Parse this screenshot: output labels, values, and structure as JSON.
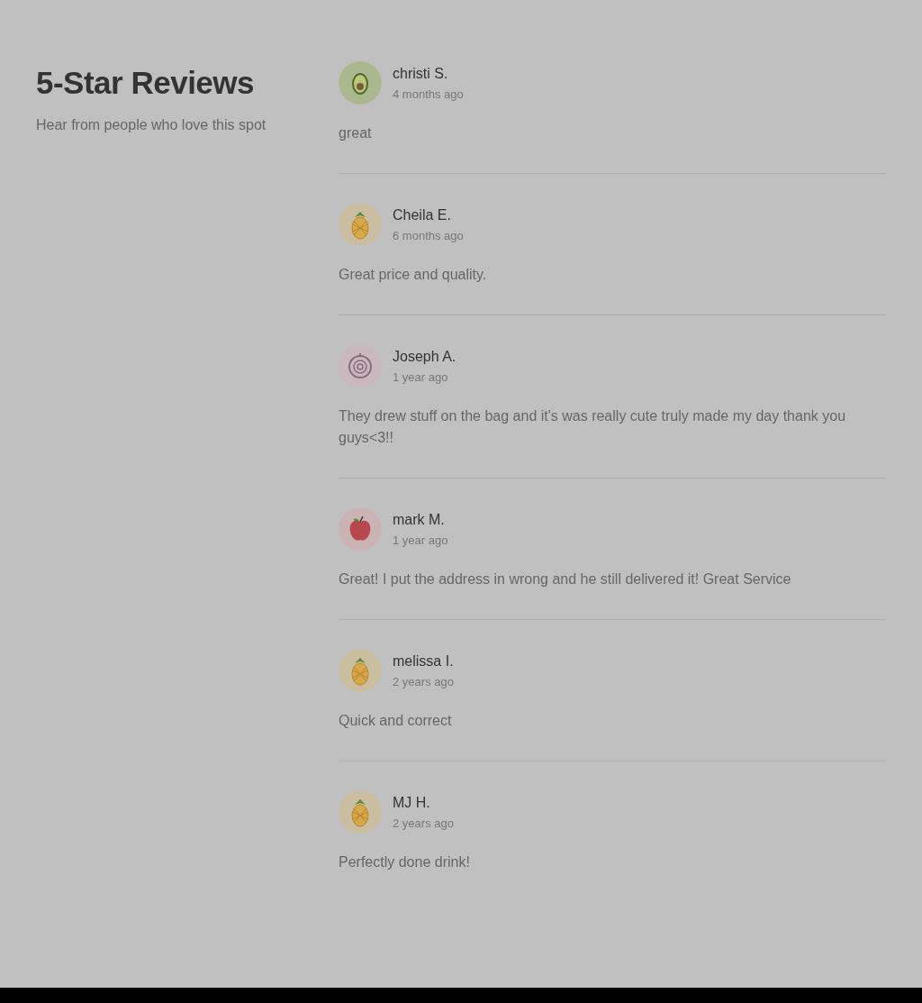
{
  "heading": {
    "title": "5-Star Reviews",
    "subtitle": "Hear from people who love this spot"
  },
  "reviews": [
    {
      "avatar": {
        "kind": "avocado"
      },
      "name": "christi S.",
      "time": "4 months ago",
      "text": "great"
    },
    {
      "avatar": {
        "kind": "pineapple"
      },
      "name": "Cheila E.",
      "time": "6 months ago",
      "text": "Great price and quality."
    },
    {
      "avatar": {
        "kind": "onion"
      },
      "name": "Joseph A.",
      "time": "1 year ago",
      "text": "They drew stuff on the bag and it's was really cute truly made my day thank you guys<3!!"
    },
    {
      "avatar": {
        "kind": "apple"
      },
      "name": "mark M.",
      "time": "1 year ago",
      "text": "Great! I put the address in wrong and he still delivered it! Great Service"
    },
    {
      "avatar": {
        "kind": "pineapple"
      },
      "name": "melissa I.",
      "time": "2 years ago",
      "text": "Quick and correct"
    },
    {
      "avatar": {
        "kind": "pineapple"
      },
      "name": "MJ H.",
      "time": "2 years ago",
      "text": "Perfectly done drink!"
    }
  ]
}
